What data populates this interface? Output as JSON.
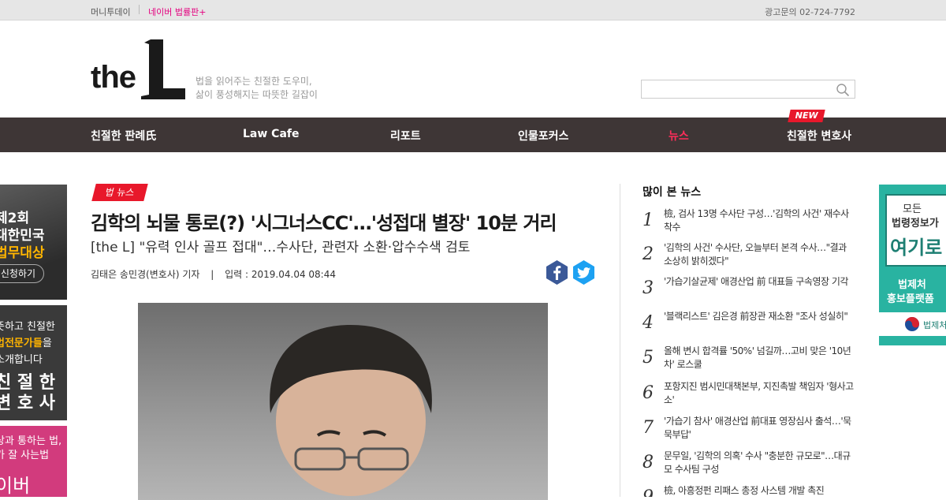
{
  "topbar": {
    "link1": "머니투데이",
    "link2": "네이버 법률판+",
    "ad_contact": "광고문의 02-724-7792"
  },
  "brand": {
    "logo_the": "the",
    "tagline1": "법을 읽어주는 친절한 도우미,",
    "tagline2": "삶이 풍성해지는 따뜻한 길잡이"
  },
  "search": {
    "placeholder": ""
  },
  "nav": {
    "items": [
      "친절한 판례氏",
      "Law Cafe",
      "리포트",
      "인물포커스",
      "뉴스",
      "친절한 변호사"
    ],
    "new_badge": "NEW",
    "active_index": 4
  },
  "left_banners": {
    "b1_line1": "제2회",
    "b1_line2": "대한민국",
    "b1_line3": "법무대상",
    "b1_btn": "신청하기",
    "b2_line1": "뜻하고 친절한",
    "b2_line2": "법전문가들",
    "b2_suffix": "을",
    "b2_line3": "소개합니다",
    "b2_big1": "친 절 한",
    "b2_big2": "변 호 사",
    "b3_line1": "상과 통하는 법,",
    "b3_line2": "가 잘 사는법",
    "b3_big": "이버"
  },
  "article": {
    "category": "법 뉴스",
    "title": "김학의 뇌물 통로(?) '시그너스CC'…'성접대 별장' 10분 거리",
    "subtitle": "[the L] \"유력 인사 골프 접대\"…수사단, 관련자 소환·압수수색 검토",
    "byline": "김태은 송민경(변호사) 기자",
    "byline_sep": "|",
    "date": "입력 : 2019.04.04 08:44"
  },
  "popular": {
    "heading": "많이 본 뉴스",
    "items": [
      {
        "num": "1",
        "text": "檢, 검사 13명 수사단 구성…'김학의 사건' 재수사 착수"
      },
      {
        "num": "2",
        "text": "'김학의 사건' 수사단, 오늘부터 본격 수사…\"결과 소상히 밝히겠다\""
      },
      {
        "num": "3",
        "text": "'가습기살균제' 애경산업 前 대표들 구속영장 기각"
      },
      {
        "num": "4",
        "text": "'블랙리스트' 김은경 前장관 재소환 \"조사 성실히\""
      },
      {
        "num": "5",
        "text": "올해 변시 합격률 '50%' 넘길까…고비 맞은 '10년차' 로스쿨"
      },
      {
        "num": "6",
        "text": "포항지진 범시민대책본부, 지진촉발 책임자 '형사고소'"
      },
      {
        "num": "7",
        "text": "'가습기 참사' 애경산업 前대표 영장심사 출석…'묵묵부답'"
      },
      {
        "num": "8",
        "text": "문무일, '김학의 의혹' 수사 \"충분한 규모로\"…대규모 수사팀 구성"
      },
      {
        "num": "9",
        "text": "檢, 아흥정펀 리패스 총정 사스템 개발 촉진"
      }
    ]
  },
  "right_banner": {
    "line1": "모든",
    "line2": "법령정보가",
    "line3": "여기로",
    "line4": "법제처",
    "line5": "홍보플랫폼",
    "logo_text": "법제처"
  },
  "colors": {
    "nav_bg": "#3e3636",
    "accent_red": "#e8182b",
    "nav_active": "#ff2d5a",
    "teal_banner": "#29b3a1"
  }
}
